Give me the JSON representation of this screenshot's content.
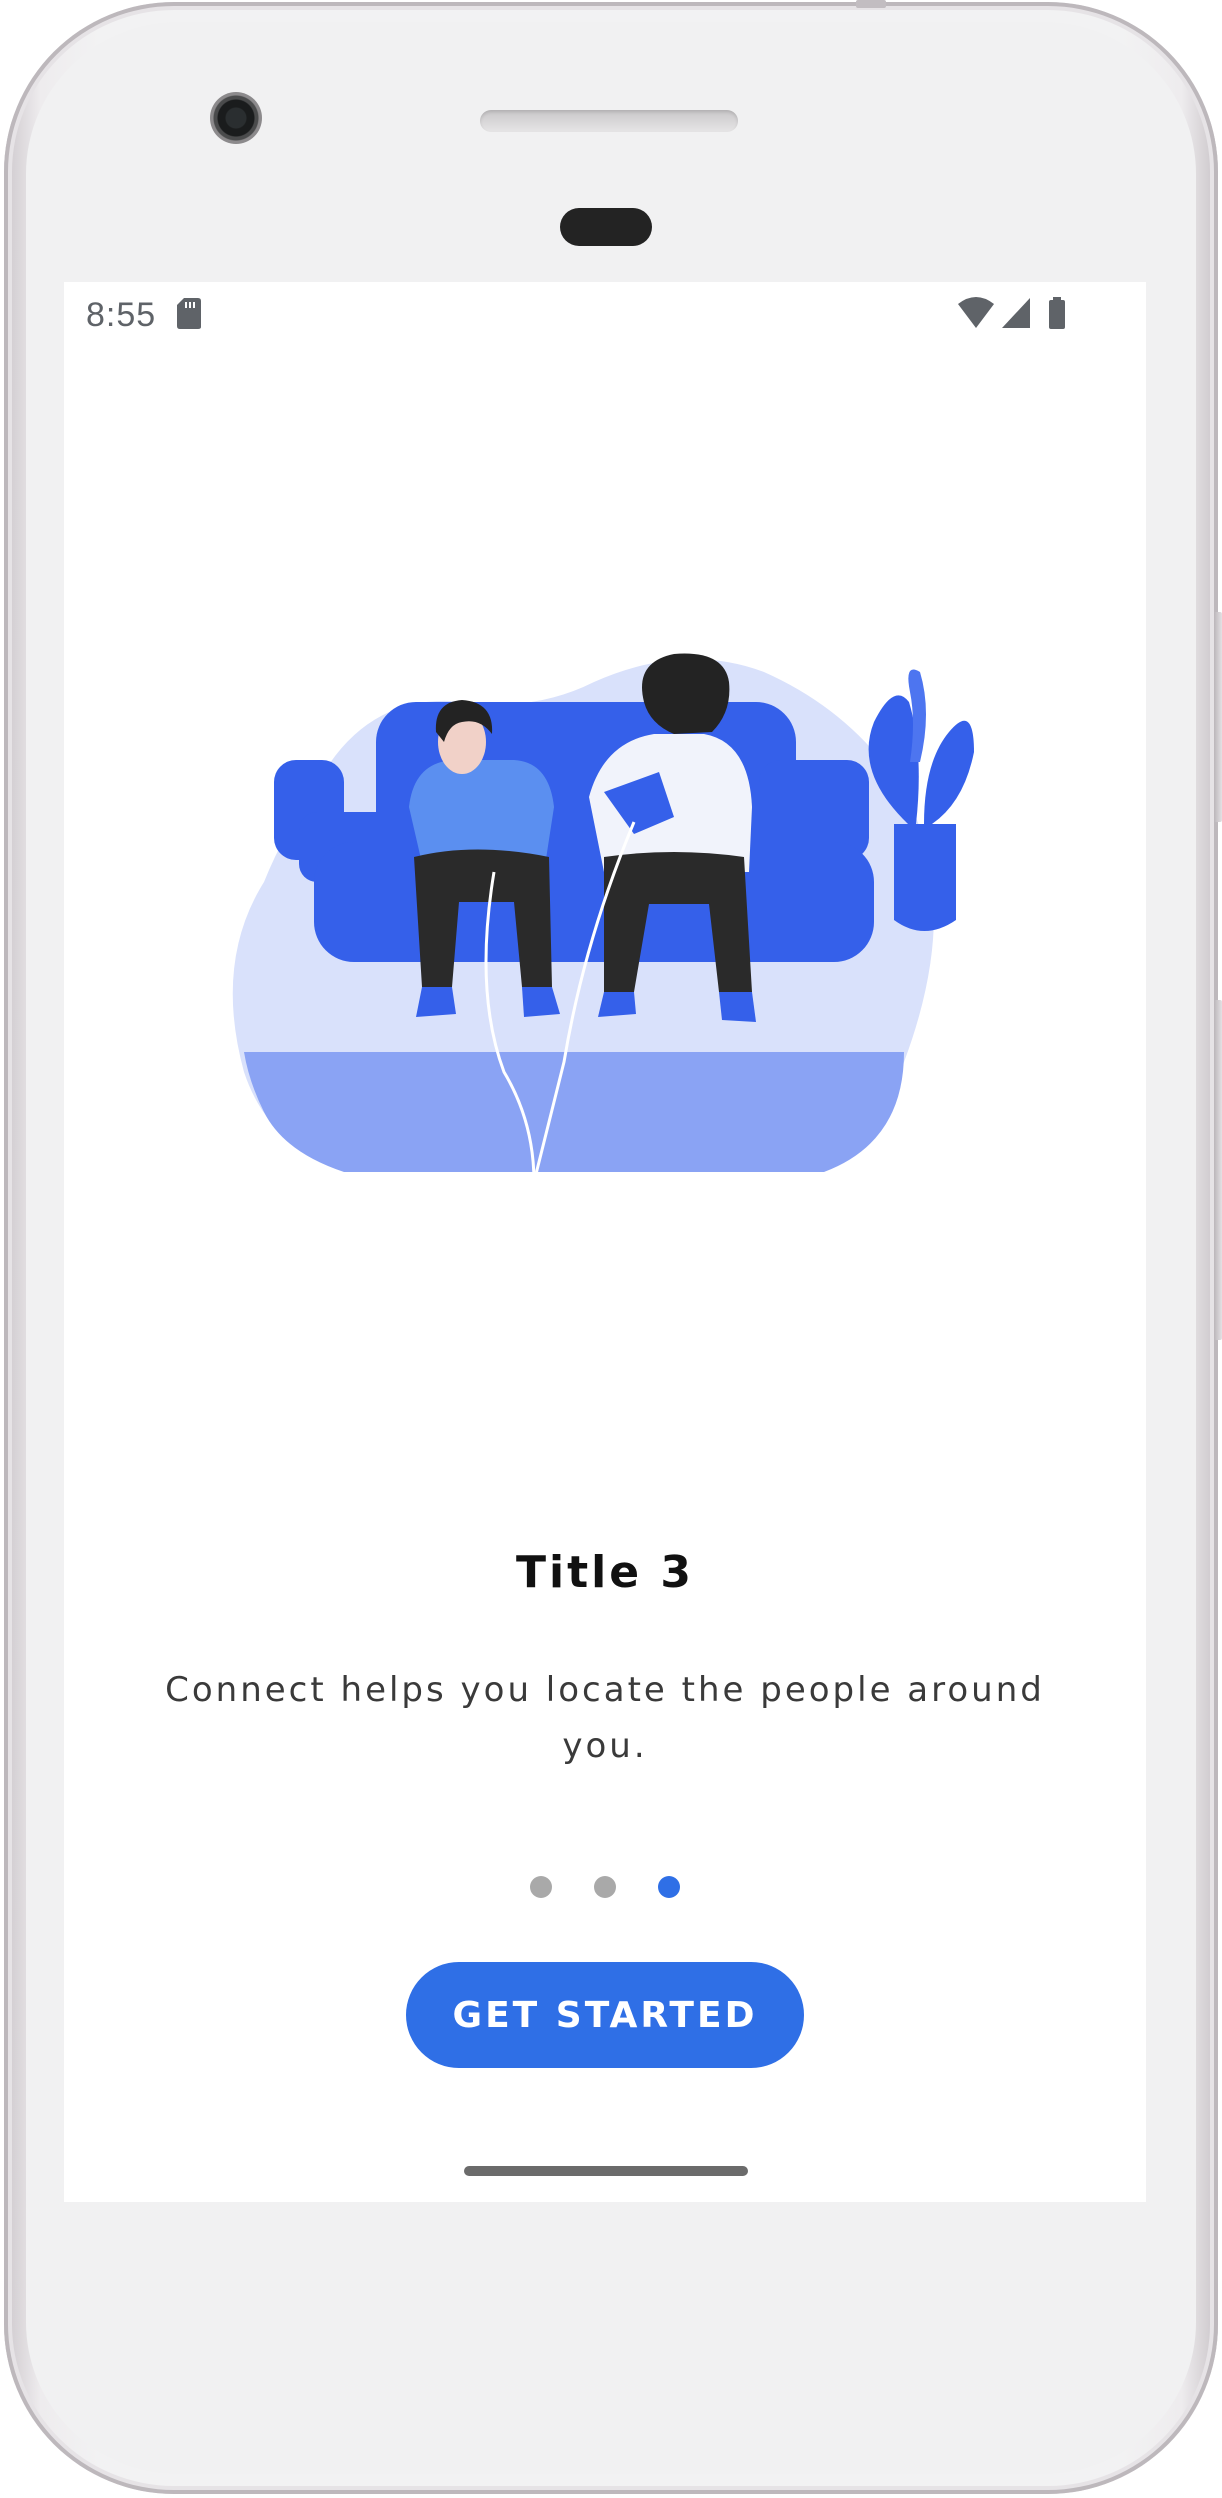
{
  "status_bar": {
    "time": "8:55",
    "icons": [
      "sd-card-icon",
      "wifi-icon",
      "cell-signal-icon",
      "battery-icon"
    ]
  },
  "onboarding": {
    "illustration": "two-people-on-couch-gaming",
    "title": "Title 3",
    "description": "Connect helps you locate the people around you.",
    "pager": {
      "total_pages": 3,
      "current_page": 3
    },
    "cta_label": "GET STARTED"
  },
  "colors": {
    "accent": "#2f6fe6",
    "dot_inactive": "#a9a9a9",
    "illustration_blue": "#3560ea",
    "illustration_light": "#d9e1fb"
  }
}
